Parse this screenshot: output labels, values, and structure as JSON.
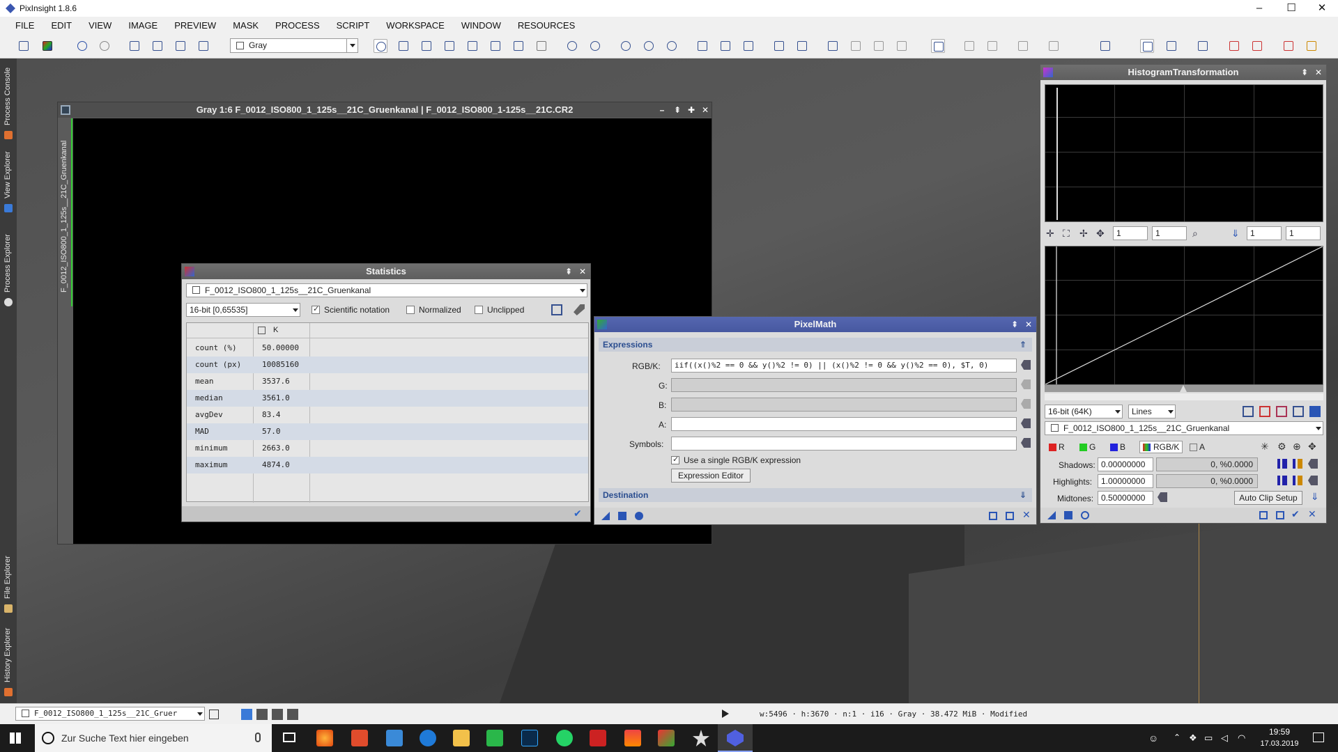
{
  "app": {
    "title": "PixInsight 1.8.6",
    "minimize": "–",
    "maximize": "☐",
    "close": "✕"
  },
  "menu": [
    "FILE",
    "EDIT",
    "VIEW",
    "IMAGE",
    "PREVIEW",
    "MASK",
    "PROCESS",
    "SCRIPT",
    "WORKSPACE",
    "WINDOW",
    "RESOURCES"
  ],
  "toolbar": {
    "view_mode": "Gray"
  },
  "left_tabs": [
    "Process Console",
    "View Explorer",
    "Process Explorer",
    "File Explorer",
    "History Explorer"
  ],
  "image_window": {
    "title": "Gray 1:6 F_0012_ISO800_1_125s__21C_Gruenkanal | F_0012_ISO800_1-125s__21C.CR2",
    "side_label": "F_0012_ISO800_1_125s__21C_Gruenkanal"
  },
  "statistics": {
    "title": "Statistics",
    "view": "F_0012_ISO800_1_125s__21C_Gruenkanal",
    "range": "16-bit [0,65535]",
    "options": [
      {
        "label": "Scientific notation",
        "checked": true
      },
      {
        "label": "Normalized",
        "checked": false
      },
      {
        "label": "Unclipped",
        "checked": false
      }
    ],
    "column": "K",
    "rows": [
      {
        "key": "count (%)",
        "value": "50.00000"
      },
      {
        "key": "count (px)",
        "value": "10085160"
      },
      {
        "key": "mean",
        "value": "3537.6"
      },
      {
        "key": "median",
        "value": "3561.0"
      },
      {
        "key": "avgDev",
        "value": "83.4"
      },
      {
        "key": "MAD",
        "value": "57.0"
      },
      {
        "key": "minimum",
        "value": "2663.0"
      },
      {
        "key": "maximum",
        "value": "4874.0"
      }
    ]
  },
  "pixelmath": {
    "title": "PixelMath",
    "section_expressions": "Expressions",
    "rgbk_label": "RGB/K:",
    "rgbk_value": "iif((x()%2 == 0 && y()%2 != 0) || (x()%2 != 0 && y()%2 == 0), $T, 0)",
    "g_label": "G:",
    "b_label": "B:",
    "a_label": "A:",
    "symbols_label": "Symbols:",
    "single_expr": "Use a single RGB/K expression",
    "expression_editor": "Expression Editor",
    "section_destination": "Destination"
  },
  "histogram": {
    "title": "HistogramTransformation",
    "zoom_h": "1",
    "zoom_v": "1",
    "zoom_h2": "1",
    "zoom_v2": "1",
    "depth": "16-bit (64K)",
    "graph_style": "Lines",
    "view": "F_0012_ISO800_1_125s__21C_Gruenkanal",
    "channels": [
      "R",
      "G",
      "B",
      "RGB/K",
      "A"
    ],
    "shadows_label": "Shadows:",
    "shadows": "0.00000000",
    "shadows_clip": "0, %0.0000",
    "highlights_label": "Highlights:",
    "highlights": "1.00000000",
    "highlights_clip": "0, %0.0000",
    "midtones_label": "Midtones:",
    "midtones": "0.50000000",
    "auto_clip": "Auto Clip Setup"
  },
  "statusbar": {
    "view": "F_0012_ISO800_1_125s__21C_Gruer",
    "info": "w:5496 · h:3670 · n:1 · i16 · Gray · 38.472 MiB · Modified"
  },
  "taskbar": {
    "search_placeholder": "Zur Suche Text hier eingeben",
    "time": "19:59",
    "date": "17.03.2019"
  }
}
